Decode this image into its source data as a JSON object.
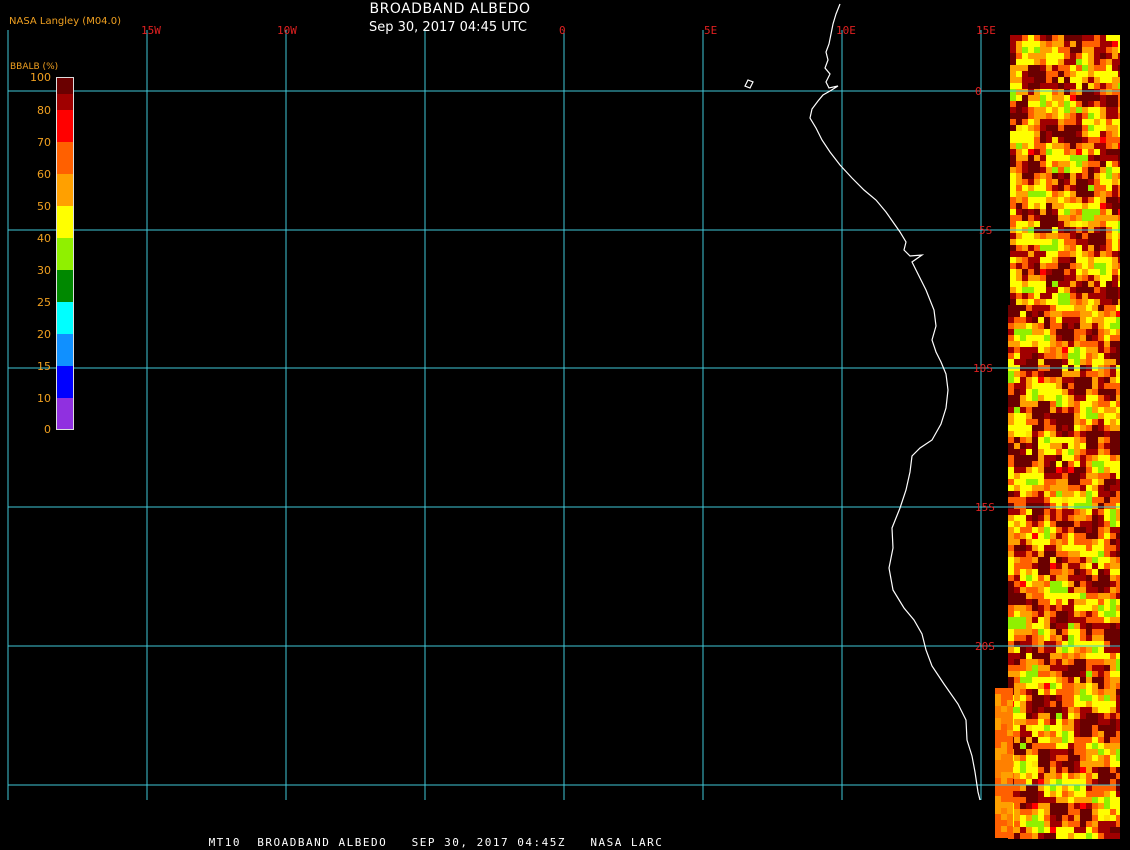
{
  "header": {
    "title": "BROADBAND ALBEDO",
    "subtitle": "Sep 30, 2017 04:45 UTC",
    "provider": "NASA Langley (M04.0)"
  },
  "footer": {
    "caption": "MT10  BROADBAND ALBEDO   SEP 30, 2017 04:45Z   NASA LARC"
  },
  "map": {
    "longitude_labels": [
      "15W",
      "10W",
      "0",
      "5E",
      "10E",
      "15E"
    ],
    "latitude_labels": [
      "0",
      "5S",
      "10S",
      "15S",
      "20S"
    ],
    "grid_color": "#40c8d8",
    "label_color": "#e02020",
    "coastline_color": "#ffffff"
  },
  "colorbar": {
    "title": "BBALB (%)",
    "labels": [
      "100",
      "80",
      "70",
      "60",
      "50",
      "40",
      "30",
      "25",
      "20",
      "15",
      "10",
      "0"
    ],
    "colors": [
      "#6a0000",
      "#a00000",
      "#ff0000",
      "#ff6000",
      "#ffa000",
      "#ffff00",
      "#90f000",
      "#008800",
      "#00ffff",
      "#1090ff",
      "#0000ff",
      "#9030e0"
    ]
  }
}
